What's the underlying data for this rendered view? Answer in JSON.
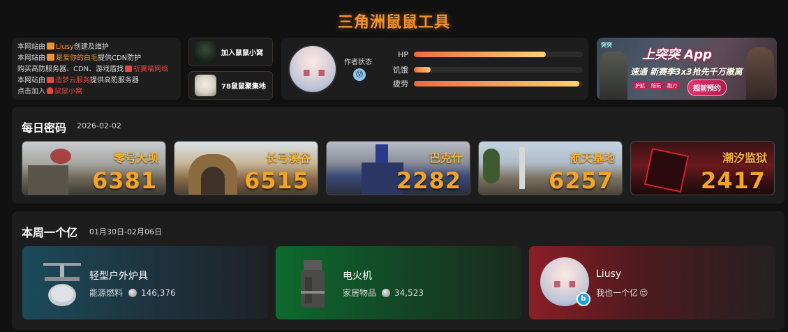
{
  "header": {
    "title": "三角洲鼠鼠工具"
  },
  "info": {
    "line1_a": "本网站由",
    "line1_link": "Liusy",
    "line1_b": "创建及维护",
    "line2_a": "本网站由",
    "line2_link": "是爱你的白毛",
    "line2_b": "提供CDN防护",
    "line3_a": "购买高防服务器、CDN、游戏盾找",
    "line3_link": "祈翼喵网络",
    "line4_a": "本网站由",
    "line4_link": "造梦云服务",
    "line4_b": "提供高防服务器",
    "line5_a": "点击加入",
    "line5_link": "鼠鼠小窝"
  },
  "groups": [
    {
      "label": "加入鼠鼠小窝",
      "icon": "group-avatar-icon"
    },
    {
      "label": "78鼠鼠聚集地",
      "icon": "group-avatar-icon"
    }
  ],
  "status": {
    "author_label": "作者状态",
    "emoji": "😰",
    "bars": [
      {
        "label": "HP",
        "value": 0.78
      },
      {
        "label": "饥饿",
        "value": 0.1
      },
      {
        "label": "疲劳",
        "value": 0.98
      }
    ]
  },
  "ad": {
    "logo": "突突",
    "title": "上突突 App",
    "subtitle": "速通 新赛季3x3抢先千万撤离",
    "tags": [
      "护航",
      "陪玩",
      "跑刀"
    ],
    "button": "超前预约"
  },
  "daily": {
    "title": "每日密码",
    "date": "2026-02-02",
    "maps": [
      {
        "name": "零号大坝",
        "code": "6381"
      },
      {
        "name": "长弓溪谷",
        "code": "6515"
      },
      {
        "name": "巴克什",
        "code": "2282"
      },
      {
        "name": "航天基地",
        "code": "6257"
      },
      {
        "name": "潮汐监狱",
        "code": "2417"
      }
    ]
  },
  "weekly": {
    "title": "本周一个亿",
    "range": "01月30日-02月06日",
    "items": [
      {
        "name": "轻型户外炉具",
        "category": "能源燃料",
        "price": "146,376"
      },
      {
        "name": "电火机",
        "category": "家居物品",
        "price": "34,523"
      }
    ],
    "user": {
      "name": "Liusy",
      "note": "我也一个亿",
      "badge": "b"
    }
  },
  "colors": {
    "accent": "#f5922a",
    "code": "#f7a323",
    "link_red": "#e8473b",
    "background": "#111111",
    "card": "#1d1d1d"
  }
}
